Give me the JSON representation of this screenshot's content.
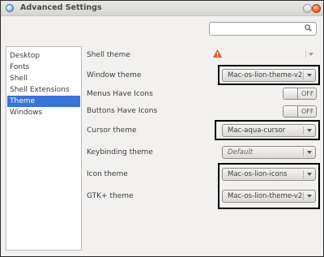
{
  "window": {
    "title": "Advanced Settings"
  },
  "search": {
    "placeholder": "",
    "value": ""
  },
  "sidebar": {
    "items": [
      {
        "label": "Desktop",
        "selected": false
      },
      {
        "label": "Fonts",
        "selected": false
      },
      {
        "label": "Shell",
        "selected": false
      },
      {
        "label": "Shell Extensions",
        "selected": false
      },
      {
        "label": "Theme",
        "selected": true
      },
      {
        "label": "Windows",
        "selected": false
      }
    ]
  },
  "settings": {
    "shell_theme": {
      "label": "Shell theme",
      "value": ""
    },
    "window_theme": {
      "label": "Window theme",
      "value": "Mac-os-lion-theme-v2"
    },
    "menus_have_icons": {
      "label": "Menus Have Icons",
      "state": "OFF"
    },
    "buttons_have_icons": {
      "label": "Buttons Have Icons",
      "state": "OFF"
    },
    "cursor_theme": {
      "label": "Cursor theme",
      "value": "Mac-aqua-cursor"
    },
    "keybinding_theme": {
      "label": "Keybinding theme",
      "value": "Default"
    },
    "icon_theme": {
      "label": "Icon theme",
      "value": "Mac-os-lion-icons"
    },
    "gtk_theme": {
      "label": "GTK+ theme",
      "value": "Mac-os-lion-theme-v2"
    }
  },
  "colors": {
    "selection": "#3875d7",
    "window_bg": "#f2f1f0",
    "highlight_border": "#000000",
    "warning": "#e8612c"
  }
}
